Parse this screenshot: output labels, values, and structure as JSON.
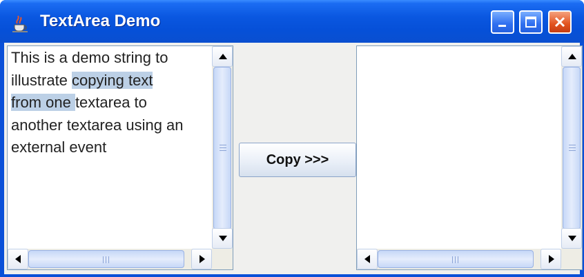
{
  "window": {
    "title": "TextArea Demo",
    "icons": [
      "java-cup-icon",
      "minimize-icon",
      "maximize-icon",
      "close-icon"
    ]
  },
  "left_textarea": {
    "lines": [
      {
        "before": "This is a demo string to",
        "selected": "",
        "after": ""
      },
      {
        "before": "illustrate ",
        "selected": "copying text",
        "after": ""
      },
      {
        "before": "",
        "selected": "from one ",
        "after": "textarea to"
      },
      {
        "before": "another textarea using an",
        "selected": "",
        "after": ""
      },
      {
        "before": "external event",
        "selected": "",
        "after": ""
      }
    ]
  },
  "copy_button": {
    "label": "Copy >>>"
  },
  "right_textarea": {
    "text": ""
  },
  "colors": {
    "titlebar": "#0a57e0",
    "selection": "#bcd0e6",
    "panel": "#f0f0ee"
  }
}
